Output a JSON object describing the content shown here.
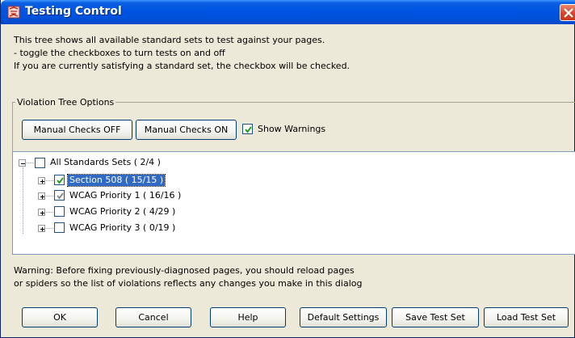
{
  "window": {
    "title": "Testing Control",
    "icons": {
      "app": "ribbon-app-icon",
      "close": "close-x-icon"
    },
    "colors": {
      "titlebar": "#0054e3",
      "close": "#d5452a",
      "selection": "#316ac5",
      "face": "#ece9d8"
    }
  },
  "description": {
    "line1": "This tree shows all available standard sets to test against your pages.",
    "line2": "- toggle the checkboxes to turn tests on and off",
    "line3": "If you are currently satisfying a standard set, the checkbox will be checked."
  },
  "options": {
    "legend": "Violation Tree Options",
    "manual_off": "Manual Checks OFF",
    "manual_on": "Manual Checks ON",
    "show_warnings": "Show Warnings",
    "show_warnings_checked": true
  },
  "tree": {
    "root": {
      "label": "All Standards Sets ( 2/4 )",
      "checked": false,
      "expanded": true
    },
    "children": [
      {
        "label": "Section 508 ( 15/15 )",
        "checked": true,
        "selected": true
      },
      {
        "label": "WCAG Priority 1 ( 16/16 )",
        "checked": true,
        "selected": false
      },
      {
        "label": "WCAG Priority 2 ( 4/29 )",
        "checked": false,
        "selected": false
      },
      {
        "label": "WCAG Priority 3 ( 0/19 )",
        "checked": false,
        "selected": false
      }
    ]
  },
  "warning": {
    "line1": "Warning: Before fixing previously-diagnosed pages, you should reload pages",
    "line2": "or spiders so the list of violations reflects any changes you make in this dialog"
  },
  "buttons": {
    "ok": "OK",
    "cancel": "Cancel",
    "help": "Help",
    "default_settings": "Default Settings",
    "save_test_set": "Save Test Set",
    "load_test_set": "Load Test Set"
  }
}
